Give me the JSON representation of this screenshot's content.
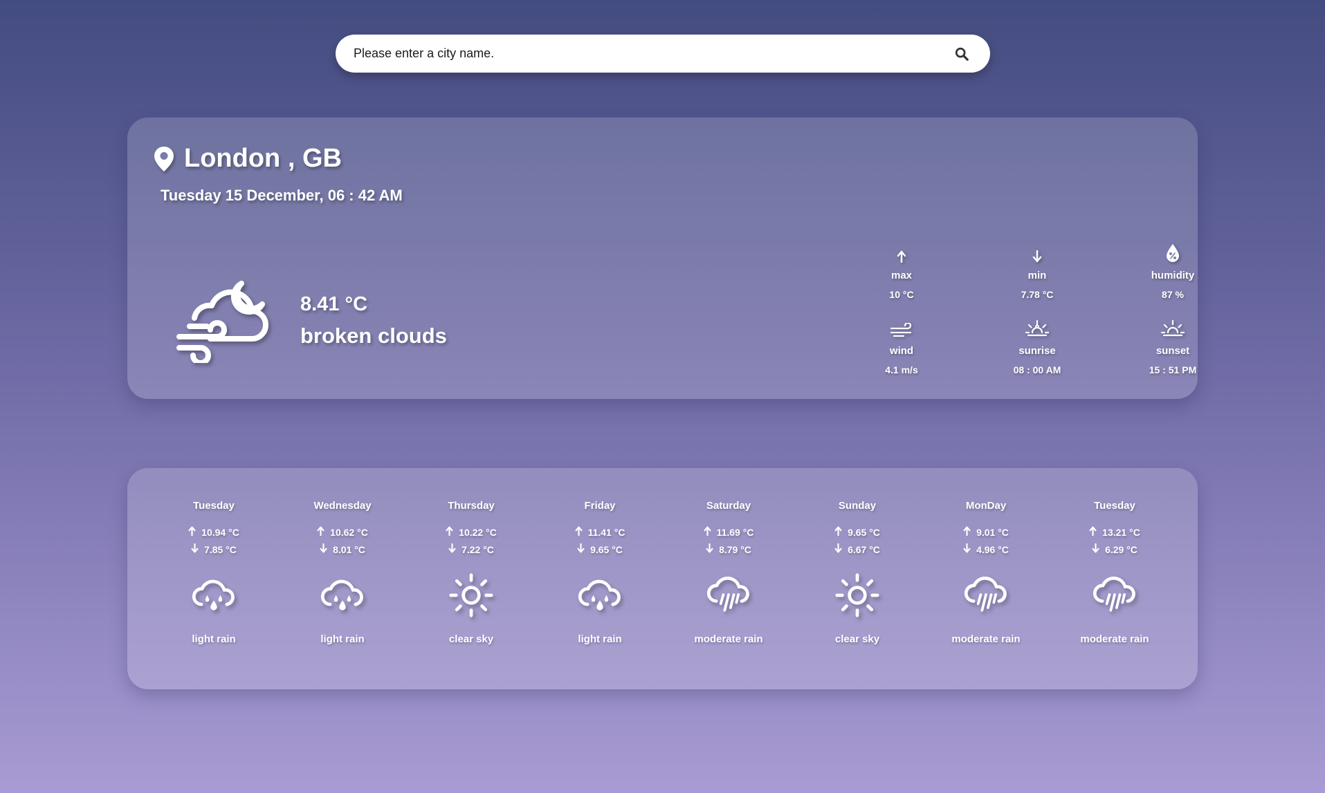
{
  "search": {
    "placeholder": "Please enter a city name."
  },
  "current": {
    "location": "London , GB",
    "datetime": "Tuesday 15 December, 06 : 42 AM",
    "temperature": "8.41 °C",
    "description": "broken clouds",
    "icon": "cloud-wind-moon-icon",
    "stats": [
      {
        "key": "max",
        "label": "max",
        "value": "10 °C",
        "icon": "arrow-up-icon"
      },
      {
        "key": "min",
        "label": "min",
        "value": "7.78 °C",
        "icon": "arrow-down-icon"
      },
      {
        "key": "humidity",
        "label": "humidity",
        "value": "87 %",
        "icon": "humidity-icon"
      },
      {
        "key": "wind",
        "label": "wind",
        "value": "4.1 m/s",
        "icon": "wind-icon"
      },
      {
        "key": "sunrise",
        "label": "sunrise",
        "value": "08 : 00 AM",
        "icon": "sunrise-icon"
      },
      {
        "key": "sunset",
        "label": "sunset",
        "value": "15 : 51 PM",
        "icon": "sunset-icon"
      }
    ]
  },
  "forecast": [
    {
      "day": "Tuesday",
      "max": "10.94 °C",
      "min": "7.85 °C",
      "condition": "light rain",
      "icon": "light-rain-icon"
    },
    {
      "day": "Wednesday",
      "max": "10.62 °C",
      "min": "8.01 °C",
      "condition": "light rain",
      "icon": "light-rain-icon"
    },
    {
      "day": "Thursday",
      "max": "10.22 °C",
      "min": "7.22 °C",
      "condition": "clear sky",
      "icon": "clear-sky-icon"
    },
    {
      "day": "Friday",
      "max": "11.41 °C",
      "min": "9.65 °C",
      "condition": "light rain",
      "icon": "light-rain-icon"
    },
    {
      "day": "Saturday",
      "max": "11.69 °C",
      "min": "8.79 °C",
      "condition": "moderate rain",
      "icon": "moderate-rain-icon"
    },
    {
      "day": "Sunday",
      "max": "9.65 °C",
      "min": "6.67 °C",
      "condition": "clear sky",
      "icon": "clear-sky-icon"
    },
    {
      "day": "MonDay",
      "max": "9.01 °C",
      "min": "4.96 °C",
      "condition": "moderate rain",
      "icon": "moderate-rain-icon"
    },
    {
      "day": "Tuesday",
      "max": "13.21 °C",
      "min": "6.29 °C",
      "condition": "moderate rain",
      "icon": "moderate-rain-icon"
    }
  ],
  "colors": {
    "bg_top": "#434c80",
    "bg_bottom": "#a99bd4",
    "text": "#ffffff"
  }
}
